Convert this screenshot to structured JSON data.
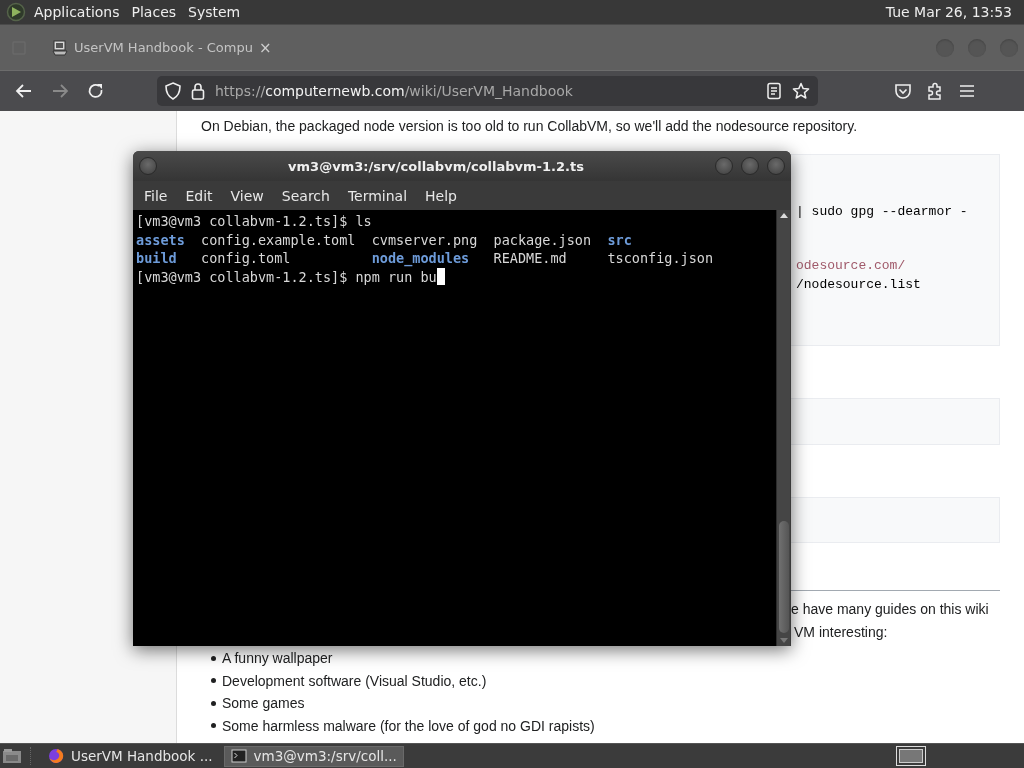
{
  "top_panel": {
    "menus": [
      "Applications",
      "Places",
      "System"
    ],
    "clock": "Tue Mar 26, 13:53"
  },
  "browser": {
    "tab": {
      "title": "UserVM Handbook - Compu",
      "close": "×"
    },
    "url": {
      "scheme": "https://",
      "host": "computernewb.com",
      "path": "/wiki/UserVM_Handbook"
    },
    "page": {
      "intro": "On Debian, the packaged node version is too old to run CollabVM, so we'll add the nodesource repository.",
      "code_blocks": [
        {
          "kind": "code",
          "groups": [
            [
              {
                "text": "| sudo gpg --dearmor -",
                "kind": "plain"
              }
            ],
            [
              {
                "text": "odesource.com/",
                "kind": "link"
              },
              {
                "text": "/nodesource.list",
                "kind": "plain"
              }
            ]
          ]
        },
        {
          "kind": "code"
        },
        {
          "kind": "code"
        }
      ],
      "paragraph_lines": [
        "e have many guides on this wiki",
        "VM interesting:"
      ],
      "bullets": [
        "A funny wallpaper",
        "Development software (Visual Studio, etc.)",
        "Some games",
        "Some harmless malware (for the love of god no GDI rapists)"
      ]
    }
  },
  "terminal": {
    "title": "vm3@vm3:/srv/collabvm/collabvm-1.2.ts",
    "menus": [
      "File",
      "Edit",
      "View",
      "Search",
      "Terminal",
      "Help"
    ],
    "lines": [
      {
        "kind": "prompt",
        "text": "[vm3@vm3 collabvm-1.2.ts]$ ls"
      },
      {
        "kind": "listing",
        "entries": [
          {
            "text": "assets",
            "kind": "dir"
          },
          {
            "text": "config.example.toml",
            "kind": "file"
          },
          {
            "text": "cvmserver.png",
            "kind": "file"
          },
          {
            "text": "package.json",
            "kind": "file"
          },
          {
            "text": "src",
            "kind": "dir"
          }
        ]
      },
      {
        "kind": "listing",
        "entries": [
          {
            "text": "build",
            "kind": "dir"
          },
          {
            "text": "config.toml",
            "kind": "file"
          },
          {
            "text": "node_modules",
            "kind": "dir"
          },
          {
            "text": "README.md",
            "kind": "file"
          },
          {
            "text": "tsconfig.json",
            "kind": "file"
          }
        ]
      },
      {
        "kind": "prompt",
        "text": "[vm3@vm3 collabvm-1.2.ts]$ npm run bu",
        "cursor": true
      }
    ]
  },
  "taskbar": {
    "tasks": [
      {
        "kind": "browser",
        "label": "UserVM Handbook ...",
        "selected": false
      },
      {
        "kind": "terminal",
        "label": "vm3@vm3:/srv/coll...",
        "selected": true
      }
    ]
  }
}
